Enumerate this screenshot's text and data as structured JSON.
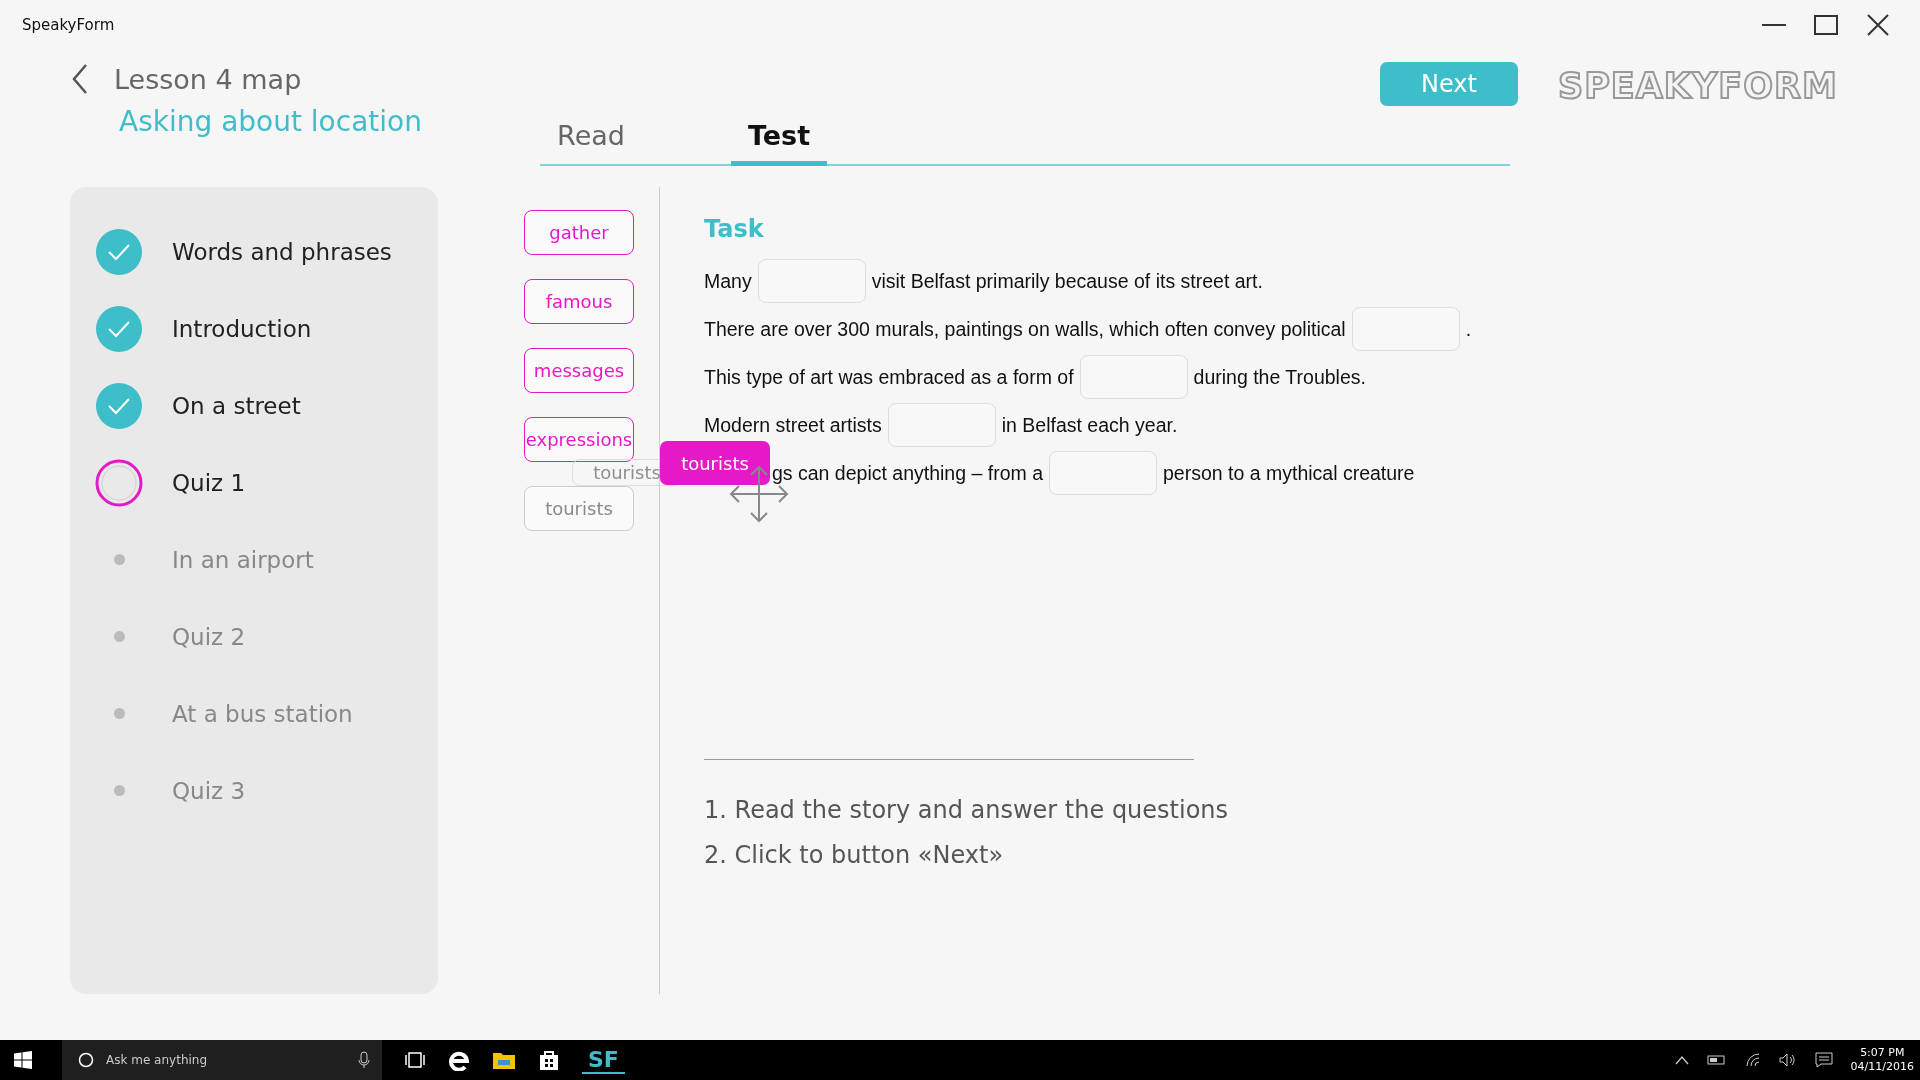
{
  "window": {
    "title": "SpeakyForm"
  },
  "header": {
    "back_label": "Lesson 4 map",
    "subtitle": "Asking about location",
    "next_button": "Next",
    "logo": "SPEAKYFORM"
  },
  "tabs": [
    {
      "label": "Read",
      "selected": false
    },
    {
      "label": "Test",
      "selected": true
    }
  ],
  "sidebar": {
    "items": [
      {
        "label": "Words and phrases",
        "kind": "done"
      },
      {
        "label": "Introduction",
        "kind": "done"
      },
      {
        "label": "On a street",
        "kind": "done"
      },
      {
        "label": "Quiz 1",
        "kind": "current"
      },
      {
        "label": "In an airport",
        "kind": "pending"
      },
      {
        "label": "Quiz 2",
        "kind": "pending"
      },
      {
        "label": "At a bus station",
        "kind": "pending"
      },
      {
        "label": "Quiz 3",
        "kind": "pending"
      }
    ]
  },
  "word_bank": [
    {
      "label": "gather",
      "placed": false
    },
    {
      "label": "famous",
      "placed": false
    },
    {
      "label": "messages",
      "placed": false
    },
    {
      "label": "expressions",
      "placed": false
    },
    {
      "label": "tourists",
      "placed": true
    }
  ],
  "drag": {
    "ghost_label": "tourists",
    "chip_label": "tourists"
  },
  "task": {
    "title": "Task",
    "sentences": [
      [
        {
          "kind": "text",
          "text": "Many"
        },
        {
          "kind": "blank"
        },
        {
          "kind": "text",
          "text": "visit Belfast primarily because of its street art."
        }
      ],
      [
        {
          "kind": "text",
          "text": "There are over 300 murals, paintings on walls, which often convey political"
        },
        {
          "kind": "blank"
        },
        {
          "kind": "text",
          "text": "."
        }
      ],
      [
        {
          "kind": "text",
          "text": "This type of art was embraced as a form of"
        },
        {
          "kind": "blank"
        },
        {
          "kind": "text",
          "text": "during the Troubles."
        }
      ],
      [
        {
          "kind": "text",
          "text": "Modern street artists"
        },
        {
          "kind": "blank"
        },
        {
          "kind": "text",
          "text": "in Belfast each year."
        }
      ],
      [
        {
          "kind": "drag"
        },
        {
          "kind": "text",
          "text": "gs can depict anything – from a"
        },
        {
          "kind": "blank"
        },
        {
          "kind": "text",
          "text": "person to a mythical creature"
        }
      ]
    ]
  },
  "instructions": [
    "1. Read the story and answer the questions",
    "2. Click to button «Next»"
  ],
  "taskbar": {
    "search_placeholder": "Ask me anything",
    "app_label": "SF",
    "time": "5:07 PM",
    "date": "04/11/2016"
  }
}
